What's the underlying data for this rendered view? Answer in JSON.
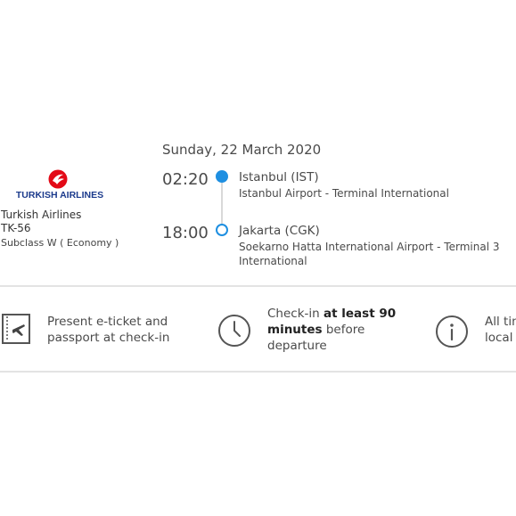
{
  "flight": {
    "date": "Sunday, 22 March 2020",
    "airline": {
      "logo_text": "TURKISH AIRLINES",
      "name": "Turkish Airlines",
      "flight_number": "TK-56",
      "subclass": "Subclass W ( Economy )"
    },
    "departure": {
      "time": "02:20",
      "city": "Istanbul (IST)",
      "airport": "Istanbul Airport - Terminal International"
    },
    "arrival": {
      "time": "18:00",
      "city": "Jakarta (CGK)",
      "airport": "Soekarno Hatta International Airport - Terminal 3 International"
    }
  },
  "info": {
    "eticket": {
      "line1": "Present e-ticket and",
      "line2": "passport at check-in",
      "icon": "eticket-icon"
    },
    "checkin": {
      "prefix": "Check-in ",
      "bold": "at least 90 minutes",
      "suffix": " before departure",
      "icon": "clock-icon"
    },
    "times": {
      "line1": "All tim",
      "line2": "local",
      "icon": "info-icon"
    }
  },
  "colors": {
    "accent": "#1e8fe1",
    "logo_red": "#e30a17",
    "logo_blue": "#1b3a8c",
    "divider": "#e3e3e3"
  }
}
